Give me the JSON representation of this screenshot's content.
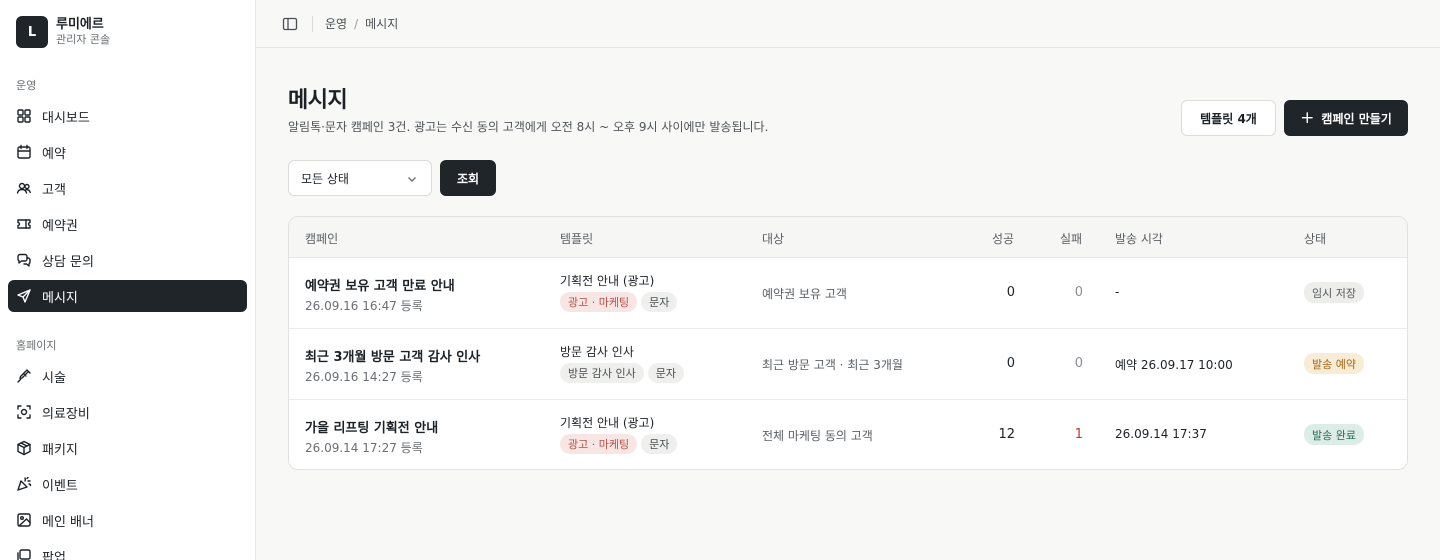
{
  "brand": {
    "logo_letter": "L",
    "name": "루미에르",
    "subtitle": "관리자 콘솔"
  },
  "sidebar": {
    "sections": [
      {
        "label": "운영",
        "items": [
          {
            "label": "대시보드",
            "icon": "dashboard-icon"
          },
          {
            "label": "예약",
            "icon": "calendar-icon"
          },
          {
            "label": "고객",
            "icon": "users-icon"
          },
          {
            "label": "예약권",
            "icon": "ticket-icon"
          },
          {
            "label": "상담 문의",
            "icon": "chat-icon"
          },
          {
            "label": "메시지",
            "icon": "send-icon",
            "active": true
          }
        ]
      },
      {
        "label": "홈페이지",
        "items": [
          {
            "label": "시술",
            "icon": "syringe-icon"
          },
          {
            "label": "의료장비",
            "icon": "scan-icon"
          },
          {
            "label": "패키지",
            "icon": "package-icon"
          },
          {
            "label": "이벤트",
            "icon": "party-icon"
          },
          {
            "label": "메인 배너",
            "icon": "image-icon"
          },
          {
            "label": "팝업",
            "icon": "popup-icon"
          }
        ]
      }
    ]
  },
  "topbar": {
    "breadcrumb": [
      "운영",
      "메시지"
    ]
  },
  "header": {
    "title": "메시지",
    "description": "알림톡·문자 캠페인 3건. 광고는 수신 동의 고객에게 오전 8시 ~ 오후 9시 사이에만 발송됩니다.",
    "templates_button": "템플릿 4개",
    "create_button": "캠페인 만들기"
  },
  "filter": {
    "status_value": "모든 상태",
    "query_button": "조회"
  },
  "table": {
    "columns": [
      "캠페인",
      "템플릿",
      "대상",
      "성공",
      "실패",
      "발송 시각",
      "상태"
    ],
    "rows": [
      {
        "name": "예약권 보유 고객 만료 안내",
        "date": "26.09.16 16:47 등록",
        "template": "기획전 안내 (광고)",
        "tags": [
          "광고 · 마케팅",
          "문자"
        ],
        "tag_ad": true,
        "target": "예약권 보유 고객",
        "success": "0",
        "fail": "0",
        "sent_time": "-",
        "status": "임시 저장",
        "status_kind": "draft"
      },
      {
        "name": "최근 3개월 방문 고객 감사 인사",
        "date": "26.09.16 14:27 등록",
        "template": "방문 감사 인사",
        "tags": [
          "방문 감사 인사",
          "문자"
        ],
        "tag_ad": false,
        "target": "최근 방문 고객 · 최근 3개월",
        "success": "0",
        "fail": "0",
        "sent_time": "예약 26.09.17 10:00",
        "status": "발송 예약",
        "status_kind": "scheduled"
      },
      {
        "name": "가을 리프팅 기획전 안내",
        "date": "26.09.14 17:27 등록",
        "template": "기획전 안내 (광고)",
        "tags": [
          "광고 · 마케팅",
          "문자"
        ],
        "tag_ad": true,
        "target": "전체 마케팅 동의 고객",
        "success": "12",
        "fail": "1",
        "sent_time": "26.09.14 17:37",
        "status": "발송 완료",
        "status_kind": "done"
      }
    ]
  }
}
